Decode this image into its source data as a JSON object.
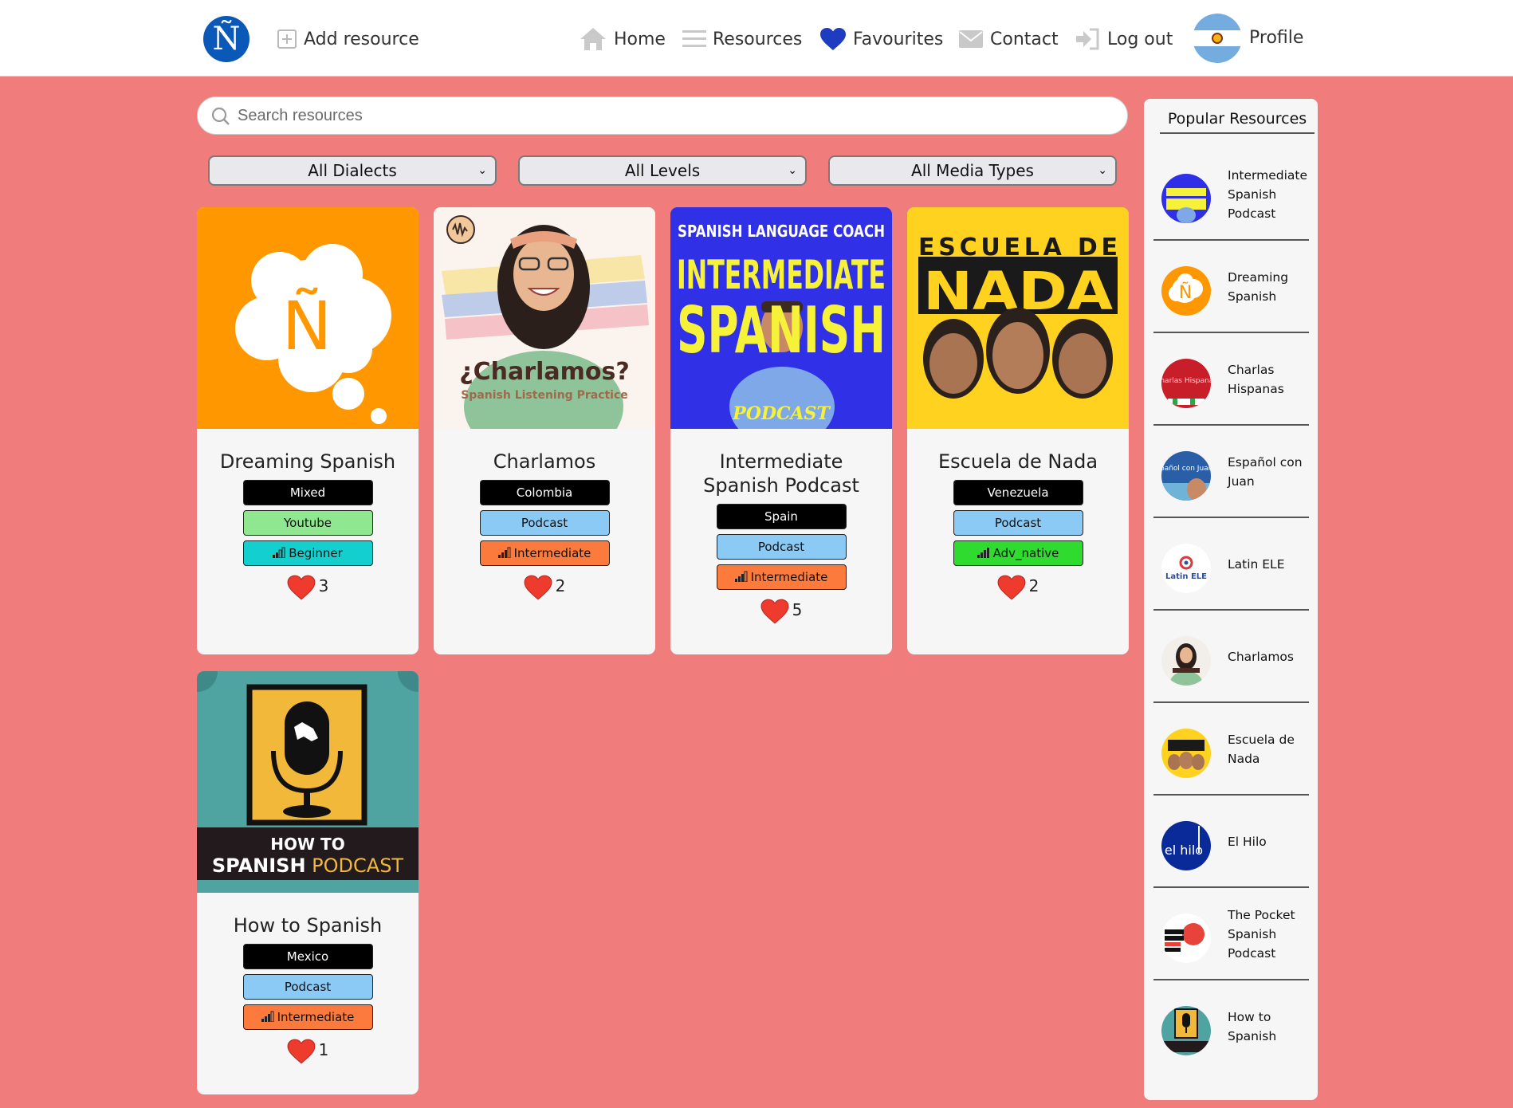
{
  "nav": {
    "add_resource": "Add resource",
    "home": "Home",
    "resources": "Resources",
    "favourites": "Favourites",
    "contact": "Contact",
    "logout": "Log out",
    "profile": "Profile"
  },
  "brand": {
    "logo_letter": "Ñ",
    "background": "#f07c7c",
    "accent": "#0a58b8"
  },
  "search": {
    "placeholder": "Search resources",
    "value": ""
  },
  "filters": {
    "dialect": "All Dialects",
    "level": "All Levels",
    "media": "All Media Types"
  },
  "cards": [
    {
      "title": "Dreaming Spanish",
      "dialect": "Mixed",
      "media": "Youtube",
      "level": "Beginner",
      "likes": "3",
      "thumb": {
        "type": "logo",
        "letter": "Ñ",
        "bg": "#ff9800"
      }
    },
    {
      "title": "Charlamos",
      "dialect": "Colombia",
      "media": "Podcast",
      "level": "Intermediate",
      "likes": "2",
      "thumb": {
        "headline": "¿Charlamos?",
        "subline": "Spanish Listening Practice"
      }
    },
    {
      "title": "Intermediate Spanish Podcast",
      "dialect": "Spain",
      "media": "Podcast",
      "level": "Intermediate",
      "likes": "5",
      "thumb": {
        "line1": "SPANISH LANGUAGE COACH",
        "line2": "INTERMEDIATE",
        "line3": "SPANISH",
        "line4": "PODCAST"
      }
    },
    {
      "title": "Escuela de Nada",
      "dialect": "Venezuela",
      "media": "Podcast",
      "level": "Adv_native",
      "likes": "2",
      "thumb": {
        "line1": "ESCUELA DE",
        "line2": "NADA"
      }
    },
    {
      "title": "How to Spanish",
      "dialect": "Mexico",
      "media": "Podcast",
      "level": "Intermediate",
      "likes": "1",
      "thumb": {
        "line1": "HOW TO",
        "line2a": "SPANISH",
        "line2b": "PODCAST"
      }
    }
  ],
  "sidebar": {
    "title": "Popular Resources",
    "items": [
      {
        "label": "Intermediate Spanish Podcast",
        "thumb_bg": "#2f2fe8"
      },
      {
        "label": "Dreaming Spanish",
        "thumb_bg": "#ff9800"
      },
      {
        "label": "Charlas Hispanas",
        "thumb_bg": "#c81e2a",
        "thumb_text": "Charlas Hispanas"
      },
      {
        "label": "Español con Juan",
        "thumb_bg": "#2a5fa8",
        "thumb_text": "Español con Juan"
      },
      {
        "label": "Latin ELE",
        "thumb_bg": "#ffffff",
        "thumb_text": "Latin ELE"
      },
      {
        "label": "Charlamos",
        "thumb_bg": "#f2eee9"
      },
      {
        "label": "Escuela de Nada",
        "thumb_bg": "#ffd21f"
      },
      {
        "label": "El Hilo",
        "thumb_bg": "#0a2a9a",
        "thumb_text": "el hilo"
      },
      {
        "label": "The Pocket Spanish Podcast",
        "thumb_bg": "#ffffff"
      },
      {
        "label": "How to Spanish",
        "thumb_bg": "#4fa3a0"
      }
    ]
  }
}
